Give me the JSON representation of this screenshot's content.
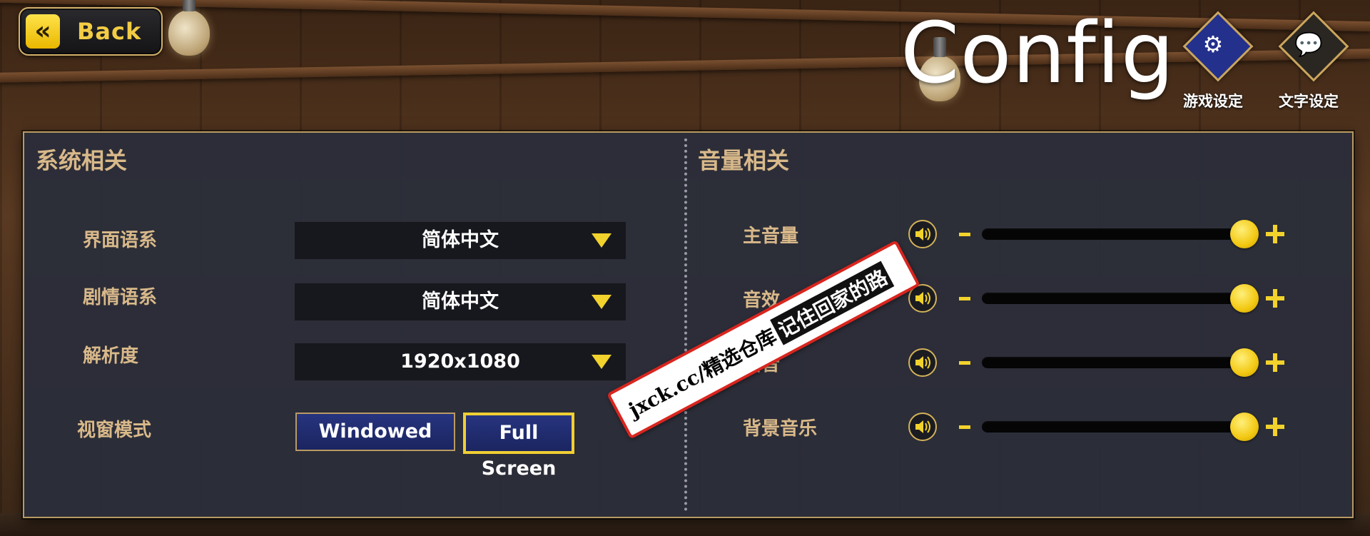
{
  "header": {
    "back_label": "Back",
    "title": "Config"
  },
  "tabs": [
    {
      "label": "游戏设定",
      "icon": "gear-icon",
      "active": true
    },
    {
      "label": "文字设定",
      "icon": "speech-bubble-icon",
      "active": false
    }
  ],
  "system": {
    "title": "系统相关",
    "ui_language": {
      "label": "界面语系",
      "value": "简体中文"
    },
    "story_language": {
      "label": "剧情语系",
      "value": "简体中文"
    },
    "resolution": {
      "label": "解析度",
      "value": "1920x1080"
    },
    "window_mode": {
      "label": "视窗模式",
      "windowed": "Windowed",
      "fullscreen": "Full Screen",
      "selected": "Full Screen"
    }
  },
  "volume": {
    "title": "音量相关",
    "items": [
      {
        "label": "主音量",
        "level": 1.0
      },
      {
        "label": "音效",
        "level": 1.0
      },
      {
        "label": "语音",
        "level": 1.0
      },
      {
        "label": "背景音乐",
        "level": 1.0
      }
    ]
  },
  "watermark": {
    "text": "jxck.cc/精选仓库",
    "highlight": "记住回家的路"
  },
  "colors": {
    "accent_yellow": "#f2d22c",
    "label_gold": "#d9b98a",
    "active_tab_blue": "#23308c",
    "button_blue": "#27347f",
    "panel_bg": "#2a2d3a"
  }
}
